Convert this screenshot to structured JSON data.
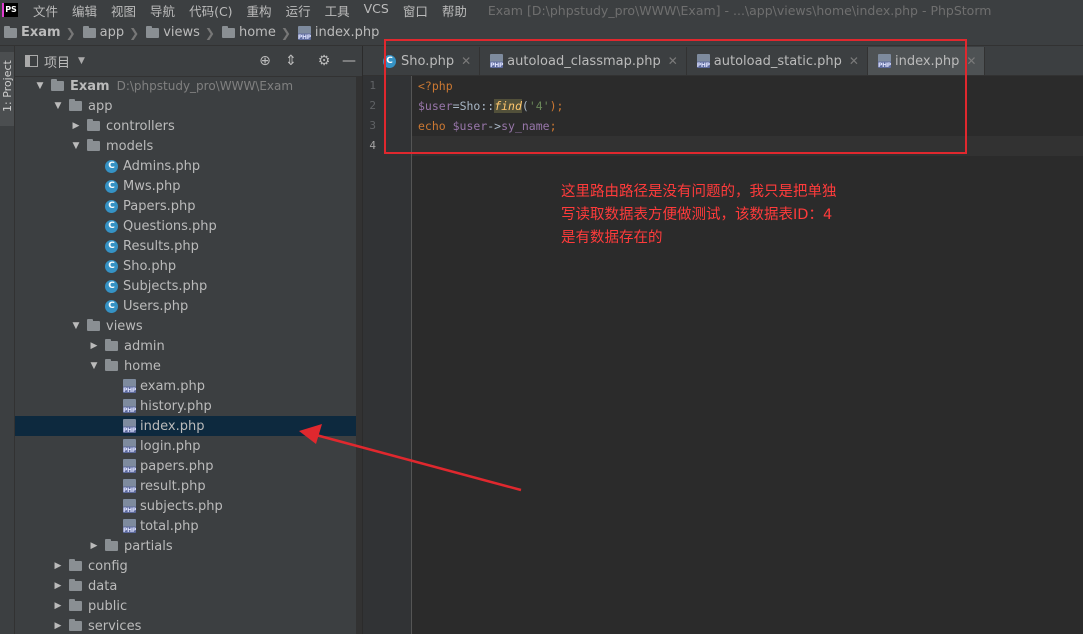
{
  "app": {
    "logo": "PS"
  },
  "menu": {
    "items": [
      "文件",
      "编辑",
      "视图",
      "导航",
      "代码(C)",
      "重构",
      "运行",
      "工具",
      "VCS",
      "窗口",
      "帮助"
    ],
    "window_title": "Exam [D:\\phpstudy_pro\\WWW\\Exam] - ...\\app\\views\\home\\index.php - PhpStorm"
  },
  "breadcrumb": [
    "Exam",
    "app",
    "views",
    "home",
    "index.php"
  ],
  "left_stripe": {
    "project_tab": "1: Project"
  },
  "project_panel": {
    "title": "项目",
    "tree": [
      {
        "label": "Exam",
        "path": "D:\\phpstudy_pro\\WWW\\Exam",
        "type": "folder",
        "arrow": "open"
      },
      {
        "label": "app",
        "type": "folder",
        "arrow": "open"
      },
      {
        "label": "controllers",
        "type": "folder",
        "arrow": "closed"
      },
      {
        "label": "models",
        "type": "folder",
        "arrow": "open"
      },
      {
        "label": "Admins.php",
        "type": "class"
      },
      {
        "label": "Mws.php",
        "type": "class"
      },
      {
        "label": "Papers.php",
        "type": "class"
      },
      {
        "label": "Questions.php",
        "type": "class"
      },
      {
        "label": "Results.php",
        "type": "class"
      },
      {
        "label": "Sho.php",
        "type": "class"
      },
      {
        "label": "Subjects.php",
        "type": "class"
      },
      {
        "label": "Users.php",
        "type": "class"
      },
      {
        "label": "views",
        "type": "folder",
        "arrow": "open"
      },
      {
        "label": "admin",
        "type": "folder",
        "arrow": "closed"
      },
      {
        "label": "home",
        "type": "folder",
        "arrow": "open"
      },
      {
        "label": "exam.php",
        "type": "php"
      },
      {
        "label": "history.php",
        "type": "php"
      },
      {
        "label": "index.php",
        "type": "php",
        "selected": true
      },
      {
        "label": "login.php",
        "type": "php"
      },
      {
        "label": "papers.php",
        "type": "php"
      },
      {
        "label": "result.php",
        "type": "php"
      },
      {
        "label": "subjects.php",
        "type": "php"
      },
      {
        "label": "total.php",
        "type": "php"
      },
      {
        "label": "partials",
        "type": "folder",
        "arrow": "closed"
      },
      {
        "label": "config",
        "type": "folder",
        "arrow": "closed"
      },
      {
        "label": "data",
        "type": "folder",
        "arrow": "closed"
      },
      {
        "label": "public",
        "type": "folder",
        "arrow": "closed"
      },
      {
        "label": "services",
        "type": "folder",
        "arrow": "closed"
      }
    ]
  },
  "editor": {
    "tabs": [
      {
        "label": "Sho.php",
        "icon": "class-icon",
        "active": false
      },
      {
        "label": "autoload_classmap.php",
        "icon": "php-file-icon",
        "active": false
      },
      {
        "label": "autoload_static.php",
        "icon": "php-file-icon",
        "active": false
      },
      {
        "label": "index.php",
        "icon": "php-file-icon",
        "active": true
      }
    ],
    "line_numbers": [
      "1",
      "2",
      "3",
      "4"
    ],
    "lines": [
      [
        {
          "t": "<?php",
          "c": "c-tag"
        }
      ],
      [
        {
          "t": "$user",
          "c": "c-var"
        },
        {
          "t": "=",
          "c": "c-plain"
        },
        {
          "t": "Sho",
          "c": "c-cls"
        },
        {
          "t": "::",
          "c": "c-plain"
        },
        {
          "t": "find",
          "c": "c-fn"
        },
        {
          "t": "(",
          "c": "c-plain"
        },
        {
          "t": "'4'",
          "c": "c-str"
        },
        {
          "t": ");",
          "c": "c-kw"
        }
      ],
      [
        {
          "t": "echo ",
          "c": "c-kw"
        },
        {
          "t": "$user",
          "c": "c-var"
        },
        {
          "t": "->",
          "c": "c-plain"
        },
        {
          "t": "sy_name",
          "c": "c-prop"
        },
        {
          "t": ";",
          "c": "c-kw"
        }
      ],
      []
    ]
  },
  "annotation": {
    "text": "这里路由路径是没有问题的，我只是把单独写读取数据表方便做测试，该数据表ID：4是有数据存在的",
    "color": "#ff3b3b"
  },
  "colors": {
    "annotation_red": "#e0282e",
    "selection": "#0d293e"
  }
}
